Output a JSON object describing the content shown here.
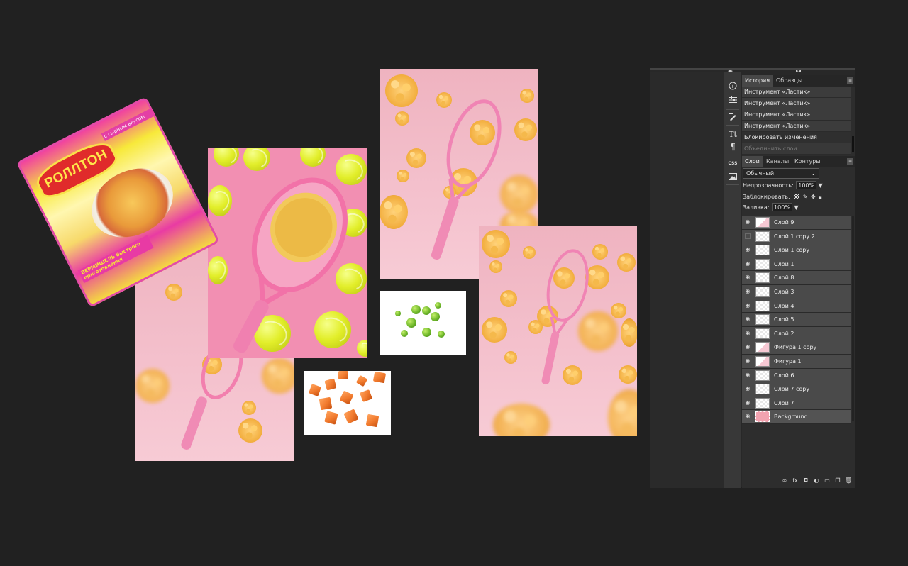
{
  "packaging": {
    "brand": "РОЛЛТОН",
    "flavor": "с сырным вкусом",
    "product": "ВЕРМИШЕЛЬ быстрого приготовления"
  },
  "history_panel": {
    "tabs": [
      "История",
      "Образцы"
    ],
    "items": [
      {
        "label": "Инструмент «Ластик»",
        "state": "normal"
      },
      {
        "label": "Инструмент «Ластик»",
        "state": "normal"
      },
      {
        "label": "Инструмент «Ластик»",
        "state": "normal"
      },
      {
        "label": "Инструмент «Ластик»",
        "state": "normal"
      },
      {
        "label": "Блокировать изменения",
        "state": "current"
      },
      {
        "label": "Объединить слои",
        "state": "dimmed"
      }
    ]
  },
  "layers_panel": {
    "tabs": [
      "Слои",
      "Каналы",
      "Контуры"
    ],
    "blend_mode": "Обычный",
    "opacity_label": "Непрозрачность:",
    "opacity_value": "100%",
    "lock_label": "Заблокировать:",
    "fill_label": "Заливка:",
    "fill_value": "100%",
    "layers": [
      {
        "name": "Слой 9",
        "visible": true
      },
      {
        "name": "Слой 1 copy 2",
        "visible": false
      },
      {
        "name": "Слой 1 copy",
        "visible": true
      },
      {
        "name": "Слой 1",
        "visible": true
      },
      {
        "name": "Слой 8",
        "visible": true
      },
      {
        "name": "Слой 3",
        "visible": true
      },
      {
        "name": "Слой 4",
        "visible": true
      },
      {
        "name": "Слой 5",
        "visible": true
      },
      {
        "name": "Слой 2",
        "visible": true
      },
      {
        "name": "Фигура 1 copy",
        "visible": true
      },
      {
        "name": "Фигура 1",
        "visible": true
      },
      {
        "name": "Слой 6",
        "visible": true
      },
      {
        "name": "Слой 7 copy",
        "visible": true
      },
      {
        "name": "Слой 7",
        "visible": true
      },
      {
        "name": "Background",
        "visible": true
      }
    ]
  },
  "toolbar": {
    "icons": [
      "info-icon",
      "properties-icon",
      "brush-icon",
      "character-icon",
      "paragraph-icon",
      "css-icon",
      "image-icon"
    ],
    "css_label": "CSS",
    "character_glyph": "Tt",
    "paragraph_glyph": "¶"
  },
  "colors": {
    "canvas_bg": "#212121",
    "panel_bg": "#2d2d2d",
    "layer_row": "#4a4a4a",
    "pink_bg": "#f4c1cd",
    "hot_pink": "#f28fb2",
    "tennis_yellow": "#e2ee2a",
    "noodle_orange": "#f2ad3d"
  }
}
